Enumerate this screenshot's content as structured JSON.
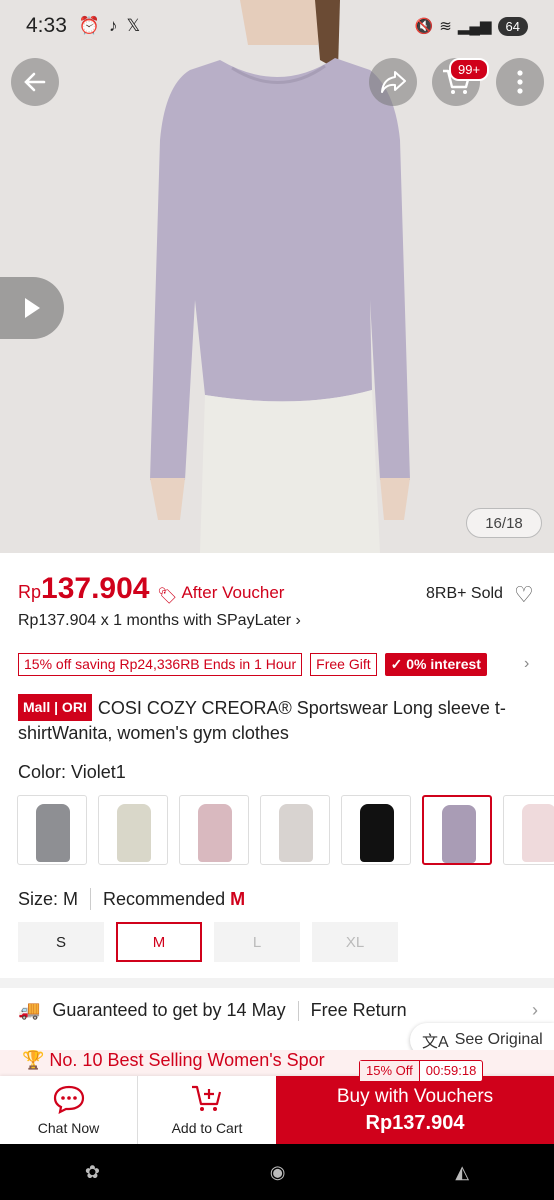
{
  "status_bar": {
    "time": "4:33",
    "battery": "64"
  },
  "header": {
    "cart_badge": "99+"
  },
  "gallery": {
    "counter": "16/18"
  },
  "price": {
    "currency": "Rp",
    "amount": "137.904",
    "after_voucher": "After Voucher",
    "sold": "8RB+ Sold",
    "spaylater": "Rp137.904 x 1 months with SPayLater"
  },
  "tags": {
    "discount": "15% off saving Rp24,336RB Ends in 1 Hour",
    "gift": "Free Gift",
    "interest": "0% interest"
  },
  "product": {
    "badge": "Mall | ORI",
    "title": "COSI COZY CREORA® Sportswear Long sleeve t-shirtWanita, women's gym clothes"
  },
  "color": {
    "label": "Color:",
    "value": "Violet1",
    "swatches": [
      "#8e8f93",
      "#d9d7c9",
      "#d9b9bf",
      "#d8d3d0",
      "#111111",
      "#a99cb5",
      "#efdadc"
    ]
  },
  "size": {
    "label": "Size:",
    "value": "M",
    "recommended_label": "Recommended",
    "recommended_value": "M",
    "options": [
      "S",
      "M",
      "L",
      "XL"
    ]
  },
  "shipping": {
    "guarantee": "Guaranteed to get by 14 May",
    "return": "Free Return"
  },
  "translate": {
    "label": "See Original"
  },
  "best_selling": {
    "text": "No. 10 Best Selling Women's Spor"
  },
  "promo": {
    "discount": "15% Off",
    "timer": "00:59:18"
  },
  "bottom_bar": {
    "chat": "Chat Now",
    "cart": "Add to Cart",
    "buy": "Buy with Vouchers",
    "buy_price": "Rp137.904"
  },
  "colors": {
    "accent": "#d0011b",
    "teal": "#26aa99"
  }
}
